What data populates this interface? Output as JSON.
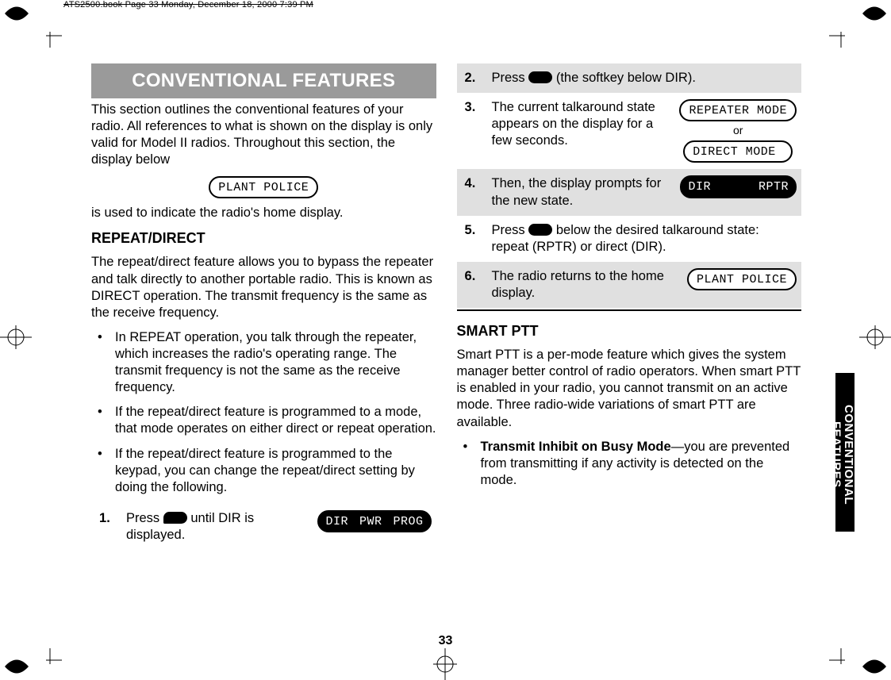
{
  "header": "ATS2500.book  Page 33  Monday, December 18, 2000  7:39 PM",
  "page_number": "33",
  "sidebar_tab": "CONVENTIONAL FEATURES",
  "left": {
    "title": "CONVENTIONAL FEATURES",
    "intro1": "This section outlines the conventional features of your radio. All references to what is shown on the display is only valid for Model II radios. Throughout this section, the display below",
    "display_home": "PLANT POLICE",
    "intro2": "is used to indicate the radio's home display.",
    "sub1": "REPEAT/DIRECT",
    "sub1_para": "The repeat/direct feature allows you to bypass the repeater and talk directly to another portable radio. This is known as DIRECT operation. The transmit frequency is the same as the receive frequency.",
    "bullets": [
      "In REPEAT operation, you talk through the repeater, which increases the radio's operating range. The transmit frequency is not the same as the receive frequency.",
      "If the repeat/direct feature is programmed to a mode, that mode operates on either direct or repeat operation.",
      "If the repeat/direct feature is programmed to the keypad, you can change the repeat/direct setting by doing the following."
    ],
    "step1_a": "Press ",
    "step1_b": " until DIR is displayed.",
    "step1_disp": [
      "DIR",
      "PWR",
      "PROG"
    ]
  },
  "right": {
    "step2_a": "Press ",
    "step2_b": " (the softkey below DIR).",
    "step3": "The current talkaround state appears on the display for a few seconds.",
    "step3_disp1": "REPEATER MODE",
    "step3_or": "or",
    "step3_disp2": "DIRECT MODE ",
    "step4": "Then, the display prompts for the new state.",
    "step4_disp": [
      "DIR",
      "RPTR"
    ],
    "step5_a": "Press ",
    "step5_b": " below the desired talkaround state: repeat (RPTR) or direct (DIR).",
    "step6": "The radio returns to the home display.",
    "step6_disp": "PLANT POLICE",
    "sub2": "SMART PTT",
    "sub2_para": "Smart PTT is a per-mode feature which gives the system manager better control of radio operators. When smart PTT is enabled in your radio, you cannot transmit on an active mode. Three radio-wide variations of smart PTT are available.",
    "bullet2_label": "Transmit Inhibit on Busy Mode",
    "bullet2_rest": "—you are prevented from transmitting if any activity is detected on the mode."
  }
}
